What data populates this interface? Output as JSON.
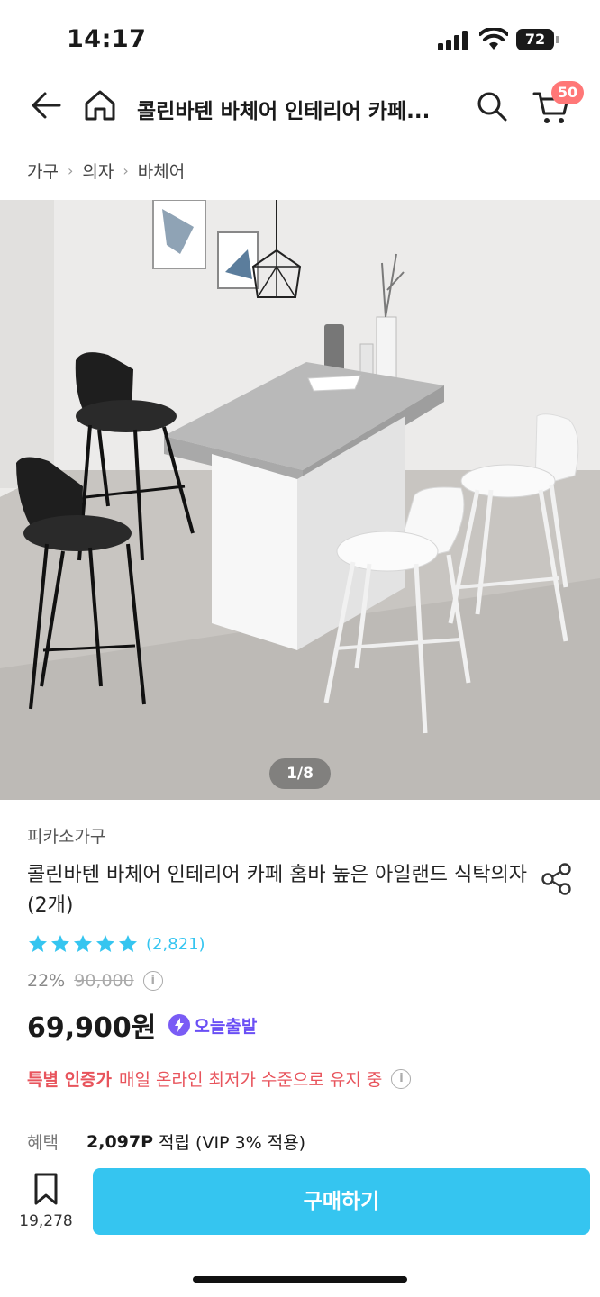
{
  "status_bar": {
    "time": "14:17",
    "battery": "72"
  },
  "header": {
    "title": "콜린바텐 바체어 인테리어 카페...",
    "cart_count": "50"
  },
  "breadcrumb": [
    "가구",
    "의자",
    "바체어"
  ],
  "gallery": {
    "counter": "1/8"
  },
  "product": {
    "brand": "피카소가구",
    "name": "콜린바텐 바체어 인테리어 카페 홈바 높은 아일랜드 식탁의자(2개)",
    "rating_stars": 5,
    "review_count": "(2,821)",
    "discount": "22%",
    "original_price": "90,000",
    "price": "69,900원",
    "delivery_badge": "오늘출발"
  },
  "certified": {
    "label": "특별 인증가",
    "text": "매일 온라인 최저가 수준으로 유지 중"
  },
  "benefit": {
    "label": "혜택",
    "points": "2,097P",
    "text": "적립 (VIP 3% 적용)"
  },
  "bottom_bar": {
    "bookmark_count": "19,278",
    "buy_label": "구매하기"
  },
  "colors": {
    "accent": "#35c5f0",
    "badge": "#f77",
    "certified": "#e8545c",
    "today": "#6a4ff5"
  }
}
